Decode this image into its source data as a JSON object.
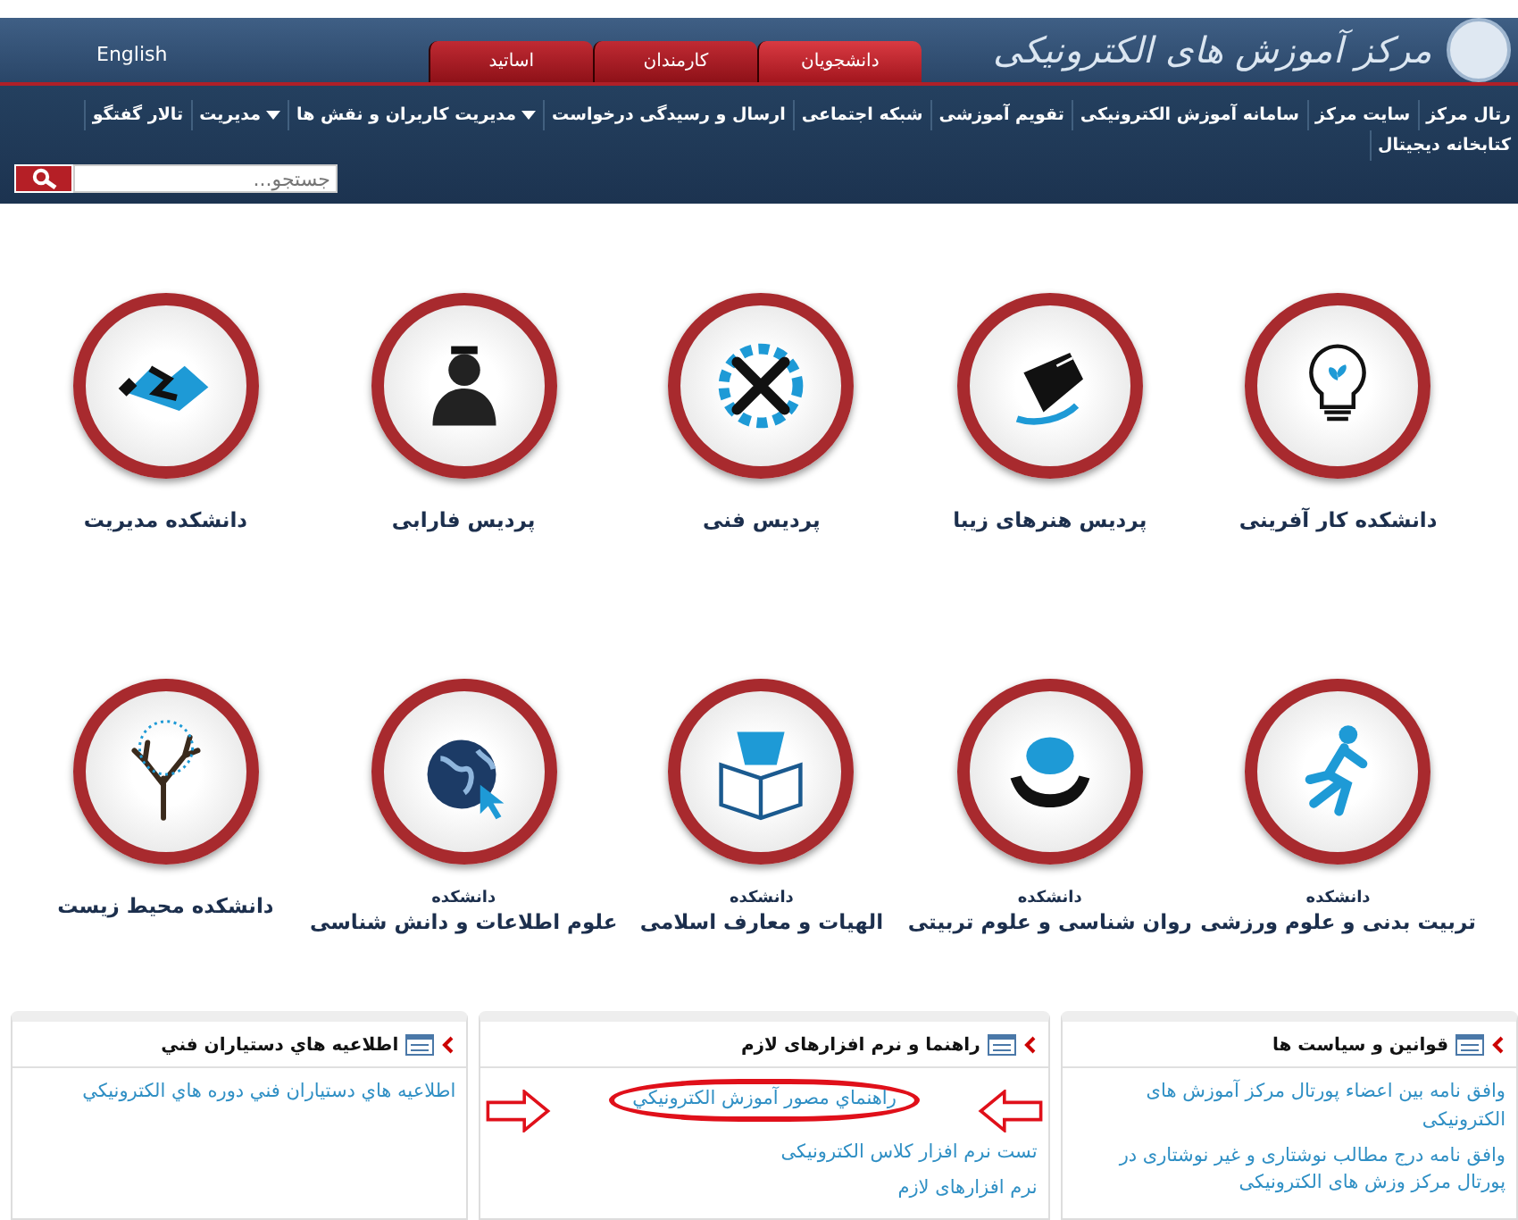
{
  "header": {
    "logo_text": "مرکز آموزش های الکترونیکی",
    "language_link": "English",
    "tabs": [
      {
        "label": "دانشجویان",
        "selected": true
      },
      {
        "label": "کارمندان",
        "selected": false
      },
      {
        "label": "اساتید",
        "selected": false
      }
    ],
    "menu": [
      {
        "label": "رتال مرکز",
        "dropdown": false
      },
      {
        "label": "سایت مرکز",
        "dropdown": false
      },
      {
        "label": "سامانه آموزش الکترونیکی",
        "dropdown": false
      },
      {
        "label": "تقویم آموزشی",
        "dropdown": false
      },
      {
        "label": "شبکه اجتماعی",
        "dropdown": false
      },
      {
        "label": "ارسال و رسیدگی درخواست",
        "dropdown": false
      },
      {
        "label": "مدیریت کاربران و نقش ها",
        "dropdown": true
      },
      {
        "label": "مدیریت",
        "dropdown": true
      },
      {
        "label": "تالار گفتگو",
        "dropdown": false
      },
      {
        "label": "کتابخانه دیجیتال",
        "dropdown": false
      }
    ],
    "search": {
      "placeholder": "جستجو..."
    }
  },
  "faculties": [
    {
      "name": "دانشکده کار آفرینی"
    },
    {
      "name": "پردیس هنرهای زیبا"
    },
    {
      "name": "پردیس فنی"
    },
    {
      "name": "پردیس فارابی"
    },
    {
      "name": "دانشکده مدیریت"
    },
    {
      "prefix": "دانشکده",
      "name": "تربیت بدنی و علوم ورزشی"
    },
    {
      "prefix": "دانشکده",
      "name": "روان شناسی و علوم تربیتی"
    },
    {
      "prefix": "دانشکده",
      "name": "الهیات و معارف اسلامی"
    },
    {
      "prefix": "دانشکده",
      "name": "علوم اطلاعات و دانش شناسی"
    },
    {
      "name": "دانشکده محیط زیست"
    }
  ],
  "panels": [
    {
      "title": "قوانین و سیاست ها",
      "links": [
        {
          "text": "وافق نامه بین اعضاء پورتال مرکز آموزش های الکترونیکی",
          "highlighted": false
        },
        {
          "text": "وافق نامه درج مطالب نوشتاری و غیر نوشتاری در پورتال مرکز وزش های الکترونیکی",
          "highlighted": false
        }
      ]
    },
    {
      "title": "راهنما و نرم افزارهای لازم",
      "links": [
        {
          "text": "راهنماي مصور آموزش الكترونيكي",
          "highlighted": true
        },
        {
          "text": "تست نرم افزار کلاس الکترونیکی",
          "highlighted": false
        },
        {
          "text": "نرم افزارهای لازم",
          "highlighted": false
        }
      ]
    },
    {
      "title": "اطلاعيه هاي دستياران فني",
      "links": [
        {
          "text": "اطلاعيه هاي دستياران فني دوره هاي الكترونيكي",
          "highlighted": false
        }
      ]
    }
  ]
}
